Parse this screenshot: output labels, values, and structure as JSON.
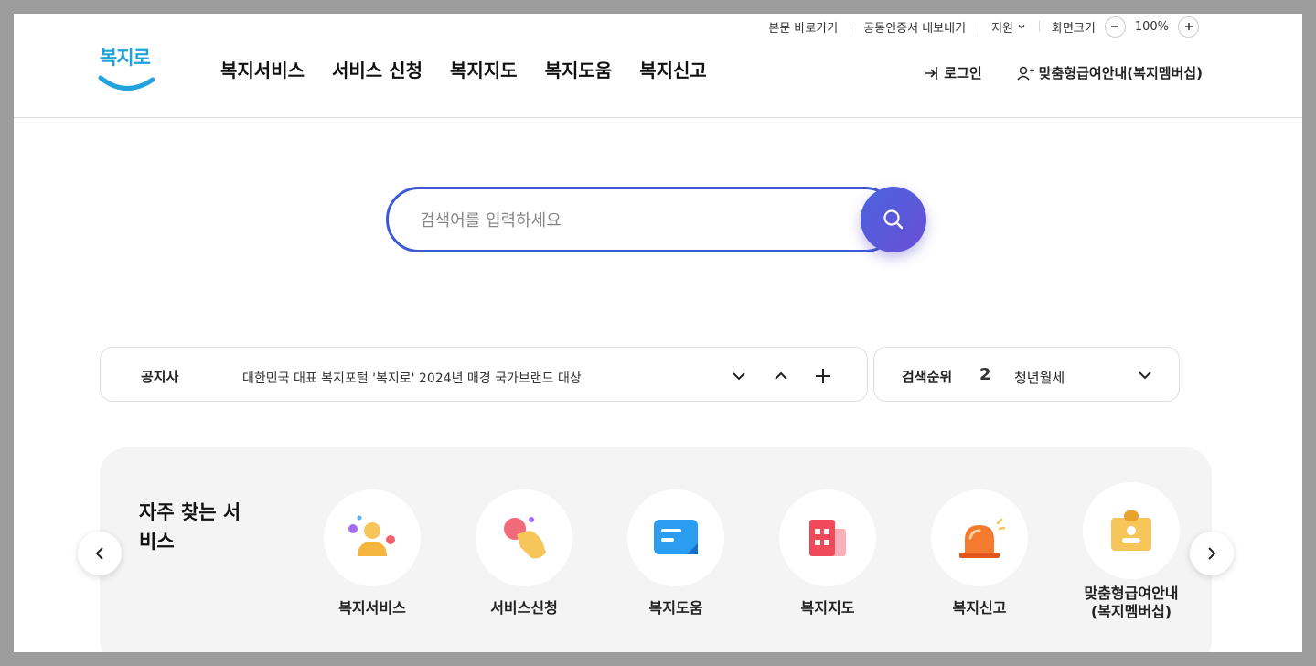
{
  "util_menu": {
    "skip_to_content": "본문 바로가기",
    "cert_export": "공동인증서 내보내기",
    "support": "지원",
    "screen_size": "화면크기",
    "zoom_level": "100%"
  },
  "logo": {
    "text": "복지로"
  },
  "gnb": [
    "복지서비스",
    "서비스 신청",
    "복지지도",
    "복지도움",
    "복지신고"
  ],
  "member": {
    "login": "로그인",
    "membership": "맞춤형급여안내(복지멤버십)"
  },
  "search": {
    "placeholder": "검색어를 입력하세요"
  },
  "notice": {
    "label": "공지사",
    "text": "대한민국 대표 복지포털 '복지로' 2024년 매경 국가브랜드 대상"
  },
  "rank": {
    "label": "검색순위",
    "number": "2",
    "keyword": "청년월세"
  },
  "freq_services": {
    "title": "자주 찾는 서비스",
    "items": [
      {
        "label": "복지서비스",
        "icon": "people-icon"
      },
      {
        "label": "서비스신청",
        "icon": "hand-touch-icon"
      },
      {
        "label": "복지도움",
        "icon": "chat-bubble-icon"
      },
      {
        "label": "복지지도",
        "icon": "building-icon"
      },
      {
        "label": "복지신고",
        "icon": "siren-icon"
      },
      {
        "label": "맞춤형급여안내\n(복지멤버십)",
        "icon": "id-card-icon"
      }
    ]
  },
  "colors": {
    "brand_blue": "#21a4dd",
    "search_border": "#3c5ad6",
    "search_btn": "#5a59da"
  }
}
